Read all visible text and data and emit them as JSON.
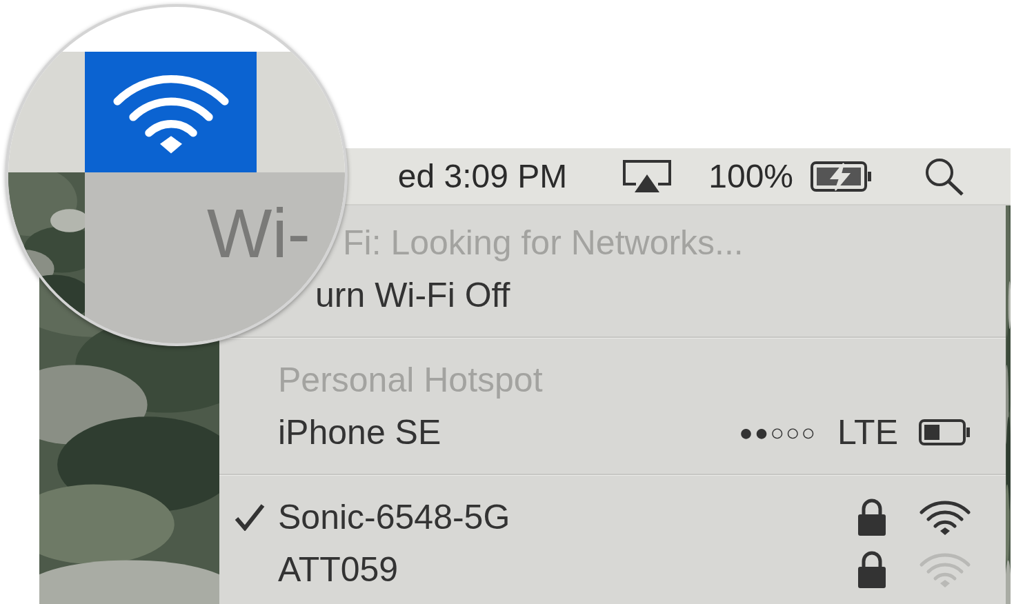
{
  "magnifier": {
    "label": "Wi-"
  },
  "menu_bar": {
    "clock": "ed 3:09 PM",
    "battery_percent": "100%"
  },
  "menu": {
    "status": "Fi: Looking for Networks...",
    "toggle": "urn Wi-Fi Off",
    "hotspot_header": "Personal Hotspot",
    "hotspots": [
      {
        "name": "iPhone SE",
        "signal": "●●○○○",
        "network": "LTE"
      }
    ],
    "networks": [
      {
        "name": "Sonic-6548-5G",
        "selected": true,
        "locked": true,
        "dimmed": false
      },
      {
        "name": "ATT059",
        "selected": false,
        "locked": true,
        "dimmed": true
      }
    ]
  }
}
